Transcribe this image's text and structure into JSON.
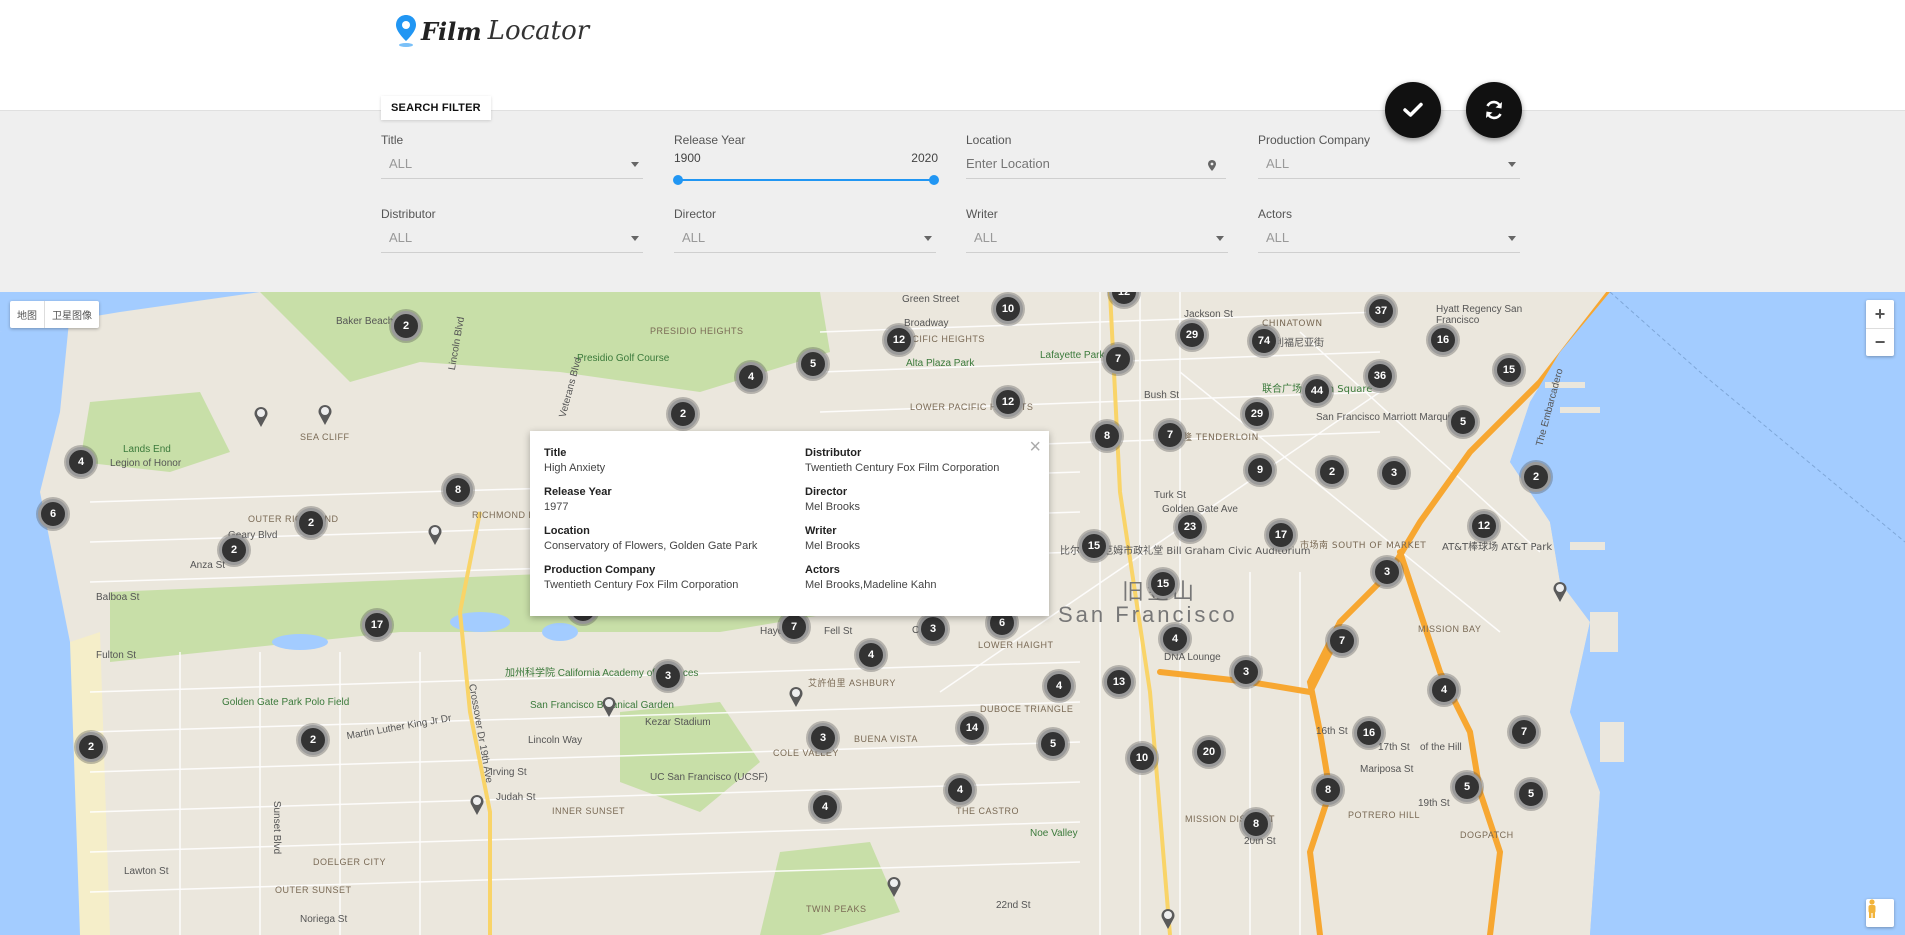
{
  "app": {
    "title_bold": "Film",
    "title_italic": "Locator"
  },
  "filter": {
    "tab_label": "SEARCH FILTER",
    "title": {
      "label": "Title",
      "value": "ALL"
    },
    "release_year": {
      "label": "Release Year",
      "min": "1900",
      "max": "2020"
    },
    "location": {
      "label": "Location",
      "placeholder": "Enter Location"
    },
    "production_company": {
      "label": "Production Company",
      "value": "ALL"
    },
    "distributor": {
      "label": "Distributor",
      "value": "ALL"
    },
    "director": {
      "label": "Director",
      "value": "ALL"
    },
    "writer": {
      "label": "Writer",
      "value": "ALL"
    },
    "actors": {
      "label": "Actors",
      "value": "ALL"
    }
  },
  "actions": {
    "apply_icon": "check-icon",
    "refresh_icon": "refresh-icon"
  },
  "map": {
    "type_buttons": [
      "地图",
      "卫星图像"
    ],
    "zoom_in": "+",
    "zoom_out": "−",
    "labels": {
      "baker_beach": "Baker Beach",
      "lincoln_blvd": "Lincoln Blvd",
      "veterans_blvd": "Veterans Blvd",
      "presidio_golf": "Presidio Golf Course",
      "presidio_heights": "PRESIDIO HEIGHTS",
      "sea_cliff": "SEA CLIFF",
      "lands_end": "Lands End",
      "legion": "Legion of Honor",
      "outer_richmond": "OUTER RICHMOND",
      "richmond_district": "RICHMOND DISTRICT",
      "geary_blvd": "Geary Blvd",
      "anza_st": "Anza St",
      "balboa_st": "Balboa St",
      "fulton_st": "Fulton St",
      "gg_park": "Golden Gate Park Polo Field",
      "cal_academy": "加州科学院 California Academy of Sciences",
      "botanical": "San Francisco Botanical Garden",
      "kezar": "Kezar Stadium",
      "ucsf": "UC San Francisco (UCSF)",
      "inner_sunset": "INNER SUNSET",
      "outer_sunset": "OUTER SUNSET",
      "doelger": "DOELGER CITY",
      "noriega": "Noriega St",
      "lawton": "Lawton St",
      "irving": "Irving St",
      "judah": "Judah St",
      "lincoln_way": "Lincoln Way",
      "mlk": "Martin Luther King Jr Dr",
      "crossover": "Crossover Dr 19th Ave",
      "sunset_blvd": "Sunset Blvd",
      "hayes": "Hayes St",
      "fell": "Fell St",
      "oak": "Oak St",
      "lower_haight": "LOWER HAIGHT",
      "ashbury": "艾許伯里 ASHBURY",
      "buena_vista": "BUENA VISTA",
      "cole_valley": "COLE VALLEY",
      "duboce": "DUBOCE TRIANGLE",
      "castro": "THE CASTRO",
      "twin_peaks": "TWIN PEAKS",
      "noe_valley": "Noe Valley",
      "alta_plaza": "Alta Plaza Park",
      "pacific_heights": "PACIFIC HEIGHTS",
      "lower_pacific": "LOWER PACIFIC HEIGHTS",
      "lafayette": "Lafayette Park",
      "chinatown": "CHINATOWN",
      "union_sq": "联合广场 Union Square",
      "marriott": "San Francisco Marriott Marquis",
      "tenderloin": "田德隆 TENDERLOIN",
      "civic": "比尔·格雷厄姆市政礼堂 Bill Graham Civic Auditorium",
      "sf_cn": "旧金山",
      "sf": "San Francisco",
      "soma": "市场南 SOUTH OF MARKET",
      "att": "AT&T棒球场 AT&T Park",
      "mission_bay": "MISSION BAY",
      "dna": "DNA Lounge",
      "mission": "MISSION DISTRICT",
      "potrero": "POTRERO HILL",
      "dogpatch": "DOGPATCH",
      "hyde": "Hyde St",
      "jackson": "Jackson St",
      "broadway": "Broadway",
      "green": "Green Street",
      "bush": "Bush St",
      "turk": "Turk St",
      "golden_gate_ave": "Golden Gate Ave",
      "16th": "16th St",
      "17th": "17th St",
      "19th": "19th St",
      "20th": "20th St",
      "22nd": "22nd St",
      "mariposa": "Mariposa St",
      "embarcadero": "The Embarcadero",
      "hill": "of the Hill",
      "regency": "Hyatt Regency San Francisco",
      "chinese_town": "加利福尼亚街"
    },
    "clusters": [
      {
        "n": "2"
      },
      {
        "n": "10"
      },
      {
        "n": "12"
      },
      {
        "n": "12"
      },
      {
        "n": "29"
      },
      {
        "n": "74"
      },
      {
        "n": "37"
      },
      {
        "n": "16"
      },
      {
        "n": "15"
      },
      {
        "n": "4"
      },
      {
        "n": "5"
      },
      {
        "n": "2"
      },
      {
        "n": "12"
      },
      {
        "n": "7"
      },
      {
        "n": "36"
      },
      {
        "n": "44"
      },
      {
        "n": "29"
      },
      {
        "n": "5"
      },
      {
        "n": "4"
      },
      {
        "n": "8"
      },
      {
        "n": "7"
      },
      {
        "n": "9"
      },
      {
        "n": "2"
      },
      {
        "n": "3"
      },
      {
        "n": "2"
      },
      {
        "n": "6"
      },
      {
        "n": "8"
      },
      {
        "n": "2"
      },
      {
        "n": "2"
      },
      {
        "n": "23"
      },
      {
        "n": "17"
      },
      {
        "n": "12"
      },
      {
        "n": "15"
      },
      {
        "n": "15"
      },
      {
        "n": "3"
      },
      {
        "n": "3"
      },
      {
        "n": "10"
      },
      {
        "n": "17"
      },
      {
        "n": "7"
      },
      {
        "n": "3"
      },
      {
        "n": "6"
      },
      {
        "n": "4"
      },
      {
        "n": "7"
      },
      {
        "n": "4"
      },
      {
        "n": "3"
      },
      {
        "n": "4"
      },
      {
        "n": "13"
      },
      {
        "n": "3"
      },
      {
        "n": "4"
      },
      {
        "n": "2"
      },
      {
        "n": "2"
      },
      {
        "n": "14"
      },
      {
        "n": "3"
      },
      {
        "n": "5"
      },
      {
        "n": "10"
      },
      {
        "n": "20"
      },
      {
        "n": "16"
      },
      {
        "n": "7"
      },
      {
        "n": "8"
      },
      {
        "n": "4"
      },
      {
        "n": "4"
      },
      {
        "n": "5"
      },
      {
        "n": "5"
      },
      {
        "n": "8"
      }
    ]
  },
  "info_window": {
    "title": {
      "key": "Title",
      "value": "High Anxiety"
    },
    "release_year": {
      "key": "Release Year",
      "value": "1977"
    },
    "location": {
      "key": "Location",
      "value": "Conservatory of Flowers, Golden Gate Park"
    },
    "production_company": {
      "key": "Production Company",
      "value": "Twentieth Century Fox Film Corporation"
    },
    "distributor": {
      "key": "Distributor",
      "value": "Twentieth Century Fox Film Corporation"
    },
    "director": {
      "key": "Director",
      "value": "Mel Brooks"
    },
    "writer": {
      "key": "Writer",
      "value": "Mel Brooks"
    },
    "actors": {
      "key": "Actors",
      "value": "Mel Brooks,Madeline Kahn"
    }
  },
  "colors": {
    "accent": "#2196f3",
    "cluster": "#333333",
    "water": "#a3ccff",
    "park": "#c8dfa8",
    "highway": "#f7a731"
  }
}
